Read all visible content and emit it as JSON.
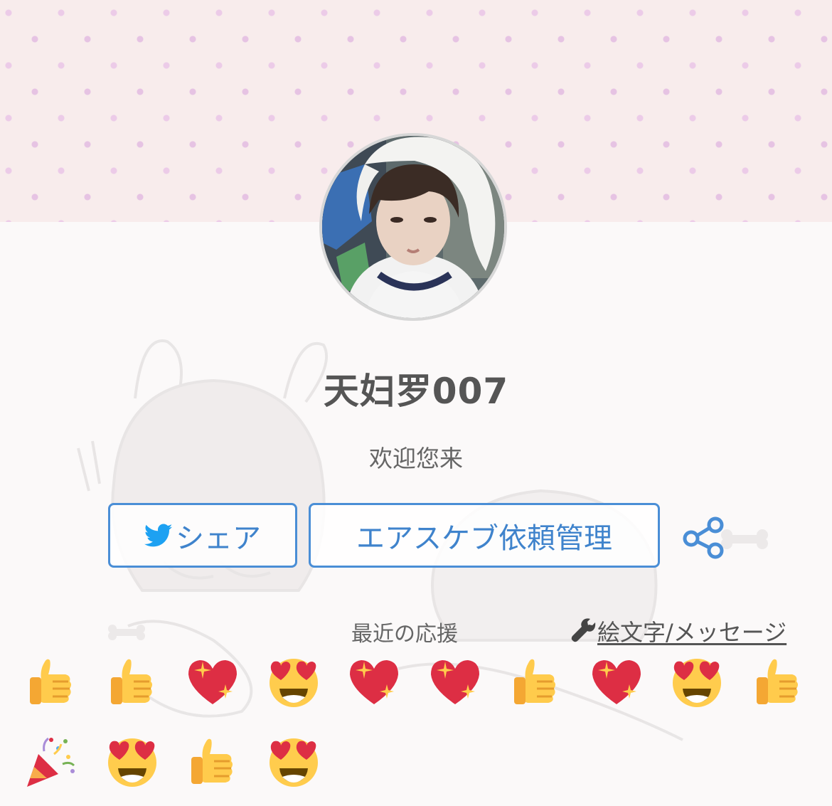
{
  "profile": {
    "name": "天妇罗007",
    "greeting": "欢迎您来"
  },
  "buttons": {
    "share_label": "シェア",
    "request_label": "エアスケブ依頼管理"
  },
  "support": {
    "recent_label": "最近の応援",
    "emoji_link_label": "絵文字/メッセージ"
  },
  "reactions": [
    {
      "icon": "thumbs-up-icon"
    },
    {
      "icon": "thumbs-up-icon"
    },
    {
      "icon": "sparkling-heart-icon"
    },
    {
      "icon": "heart-eyes-icon"
    },
    {
      "icon": "sparkling-heart-icon"
    },
    {
      "icon": "sparkling-heart-icon"
    },
    {
      "icon": "thumbs-up-icon"
    },
    {
      "icon": "sparkling-heart-icon"
    },
    {
      "icon": "heart-eyes-icon"
    },
    {
      "icon": "thumbs-up-icon"
    },
    {
      "icon": "party-popper-icon"
    },
    {
      "icon": "heart-eyes-icon"
    },
    {
      "icon": "thumbs-up-icon"
    },
    {
      "icon": "heart-eyes-icon"
    }
  ],
  "colors": {
    "accent": "#4a8ed6",
    "twitter": "#1da1f2",
    "banner": "#f8ecec",
    "dots": "#e6c3e3"
  }
}
